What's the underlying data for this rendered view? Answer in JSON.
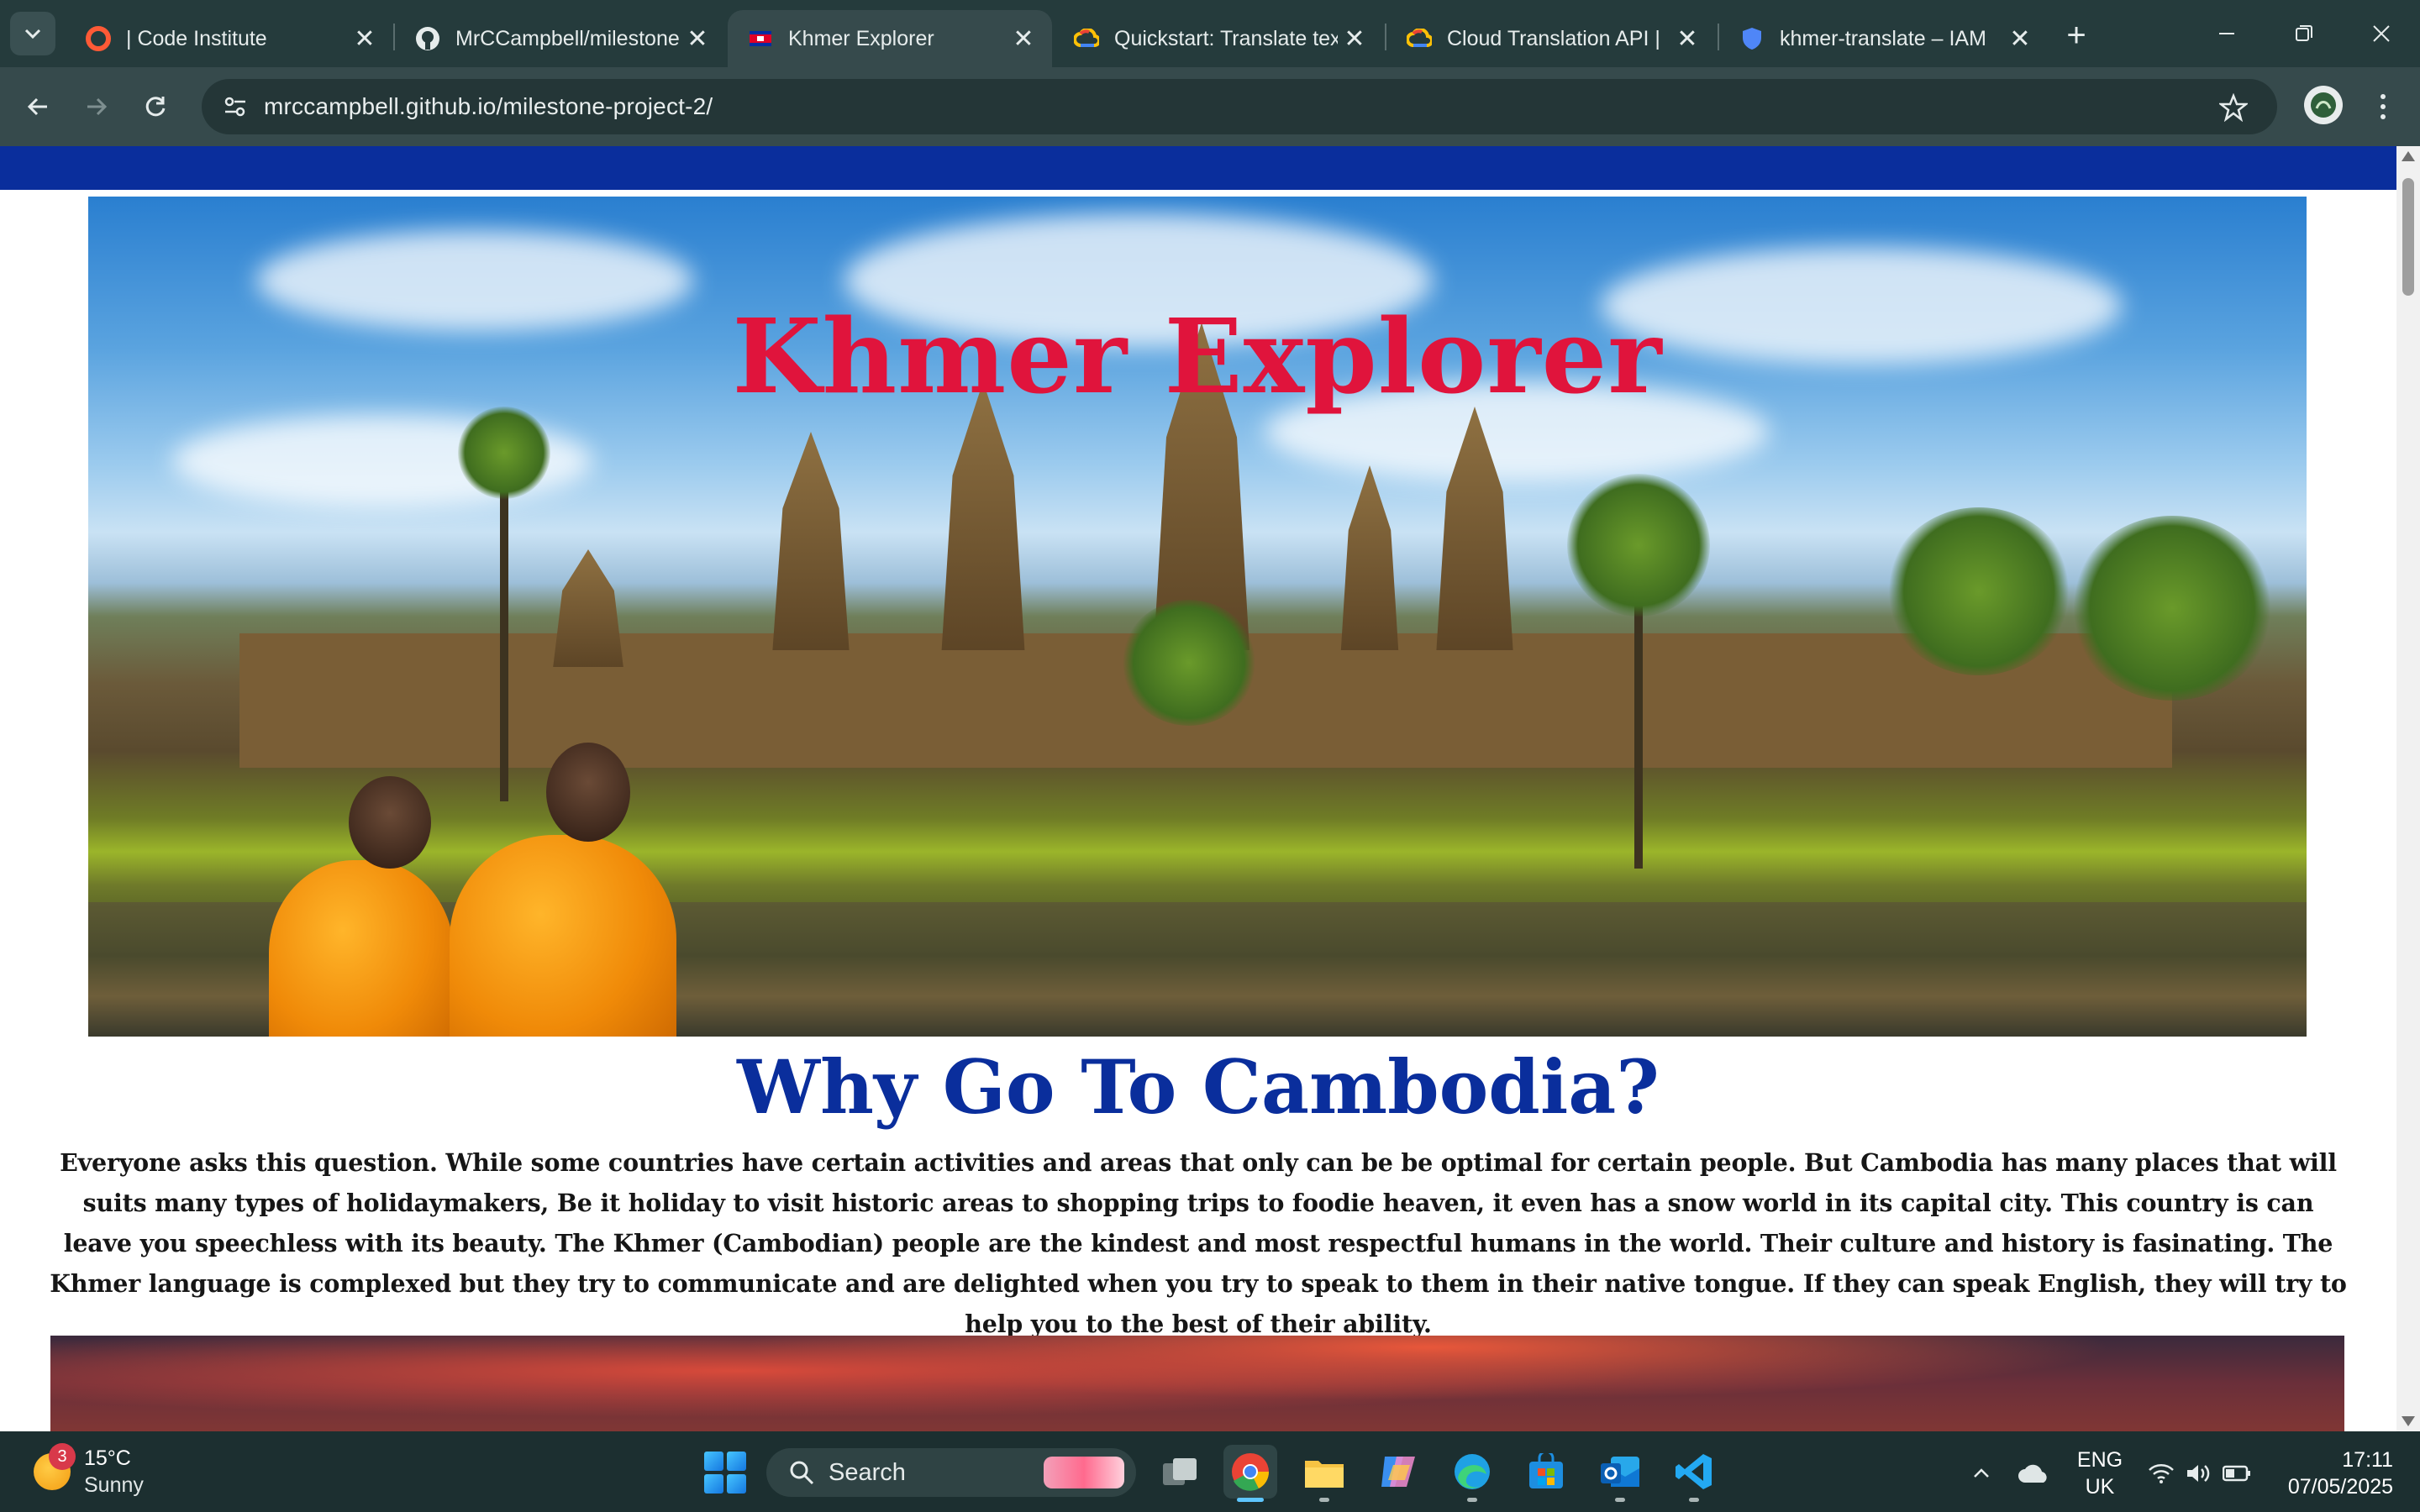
{
  "browser": {
    "tabs": [
      {
        "title": "| Code Institute",
        "icon": "code-institute-icon",
        "active": false
      },
      {
        "title": "MrCCampbell/milestone",
        "icon": "github-icon",
        "active": false
      },
      {
        "title": "Khmer Explorer",
        "icon": "cambodia-flag-icon",
        "active": true
      },
      {
        "title": "Quickstart: Translate tex",
        "icon": "google-cloud-icon",
        "active": false
      },
      {
        "title": "Cloud Translation API |",
        "icon": "google-cloud-icon",
        "active": false
      },
      {
        "title": "khmer-translate – IAM",
        "icon": "shield-icon",
        "active": false
      }
    ],
    "url": "mrccampbell.github.io/milestone-project-2/"
  },
  "page": {
    "hero_title": "Khmer Explorer",
    "section_heading": "Why Go To Cambodia?",
    "section_text": "Everyone asks this question. While some countries have certain activities and areas that only can be be optimal for certain people. But Cambodia has many places that will suits many types of holidaymakers, Be it holiday to visit historic areas to shopping trips to foodie heaven, it even has a snow world in its capital city. This country is can leave you speechless with its beauty. The Khmer (Cambodian) people are the kindest and most respectful humans in the world. Their culture and history is fasinating. The Khmer language is complexed but they try to communicate and are delighted when you try to speak to them in their native tongue. If they can speak English, they will try to help you to the best of their ability."
  },
  "taskbar": {
    "weather_badge": "3",
    "weather_temp": "15°C",
    "weather_condition": "Sunny",
    "search_label": "Search",
    "lang_line1": "ENG",
    "lang_line2": "UK",
    "time": "17:11",
    "date": "07/05/2025"
  },
  "colors": {
    "browser_frame": "#253b3c",
    "site_navbar": "#0a2e9c",
    "hero_title": "#e0143c",
    "heading": "#0a2e9c"
  }
}
